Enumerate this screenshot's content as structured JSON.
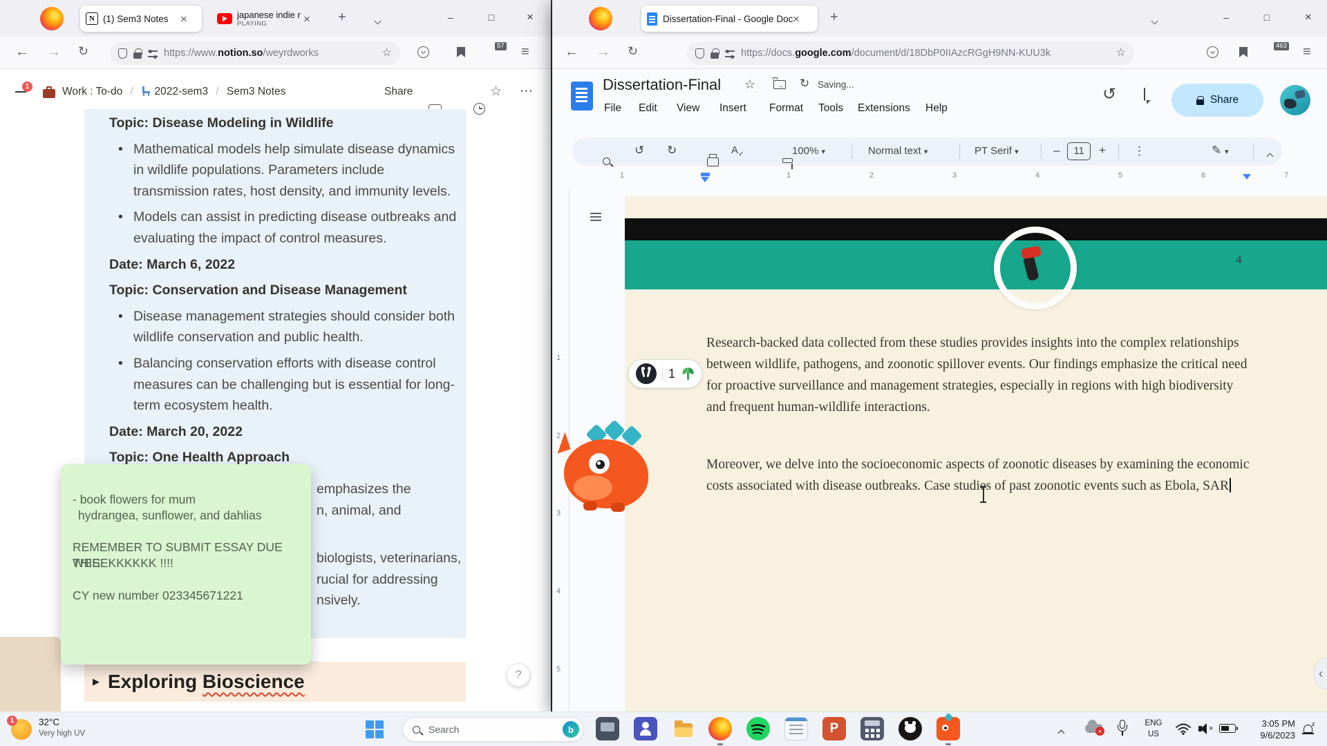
{
  "icons": {
    "back": "←",
    "forward": "→",
    "reload": "↻",
    "plus": "+",
    "close": "×",
    "menu": "≡",
    "more_h": "⋯",
    "more_v": "⋮",
    "star": "☆",
    "history": "↺",
    "chevron_left": "‹",
    "minimize": "–",
    "maximize": "□",
    "dropdown": "▾",
    "play_triangle": "▶",
    "notion_logo": "N",
    "pencil": "✎",
    "spellcheck_a": "A",
    "check": "✓",
    "letter_p": "P",
    "bing_b": "b",
    "z": "z"
  },
  "left_browser": {
    "tabs": [
      {
        "label": "(1) Sem3 Notes"
      },
      {
        "label": "japanese indie r",
        "status": "PLAYING"
      }
    ],
    "url_prefix": "https://www.",
    "url_domain": "notion.so",
    "url_path": "/weyrdworks",
    "adblock_badge": "57"
  },
  "notion": {
    "sidebar_badge": "1",
    "breadcrumb": {
      "root": "Work : To-do",
      "sep1": "/",
      "mid": "2022-sem3",
      "sep2": "/",
      "page": "Sem3 Notes"
    },
    "share_label": "Share",
    "content": {
      "topic1": "Topic: Disease Modeling in Wildlife",
      "bullet1": "Mathematical models help simulate disease dynamics in wildlife populations. Parameters include transmission rates, host density, and immunity levels.",
      "bullet2": "Models can assist in predicting disease outbreaks and evaluating the impact of control measures.",
      "date1": "Date: March 6, 2022",
      "topic2": "Topic: Conservation and Disease Management",
      "bullet3": "Disease management strategies should consider both wildlife conservation and public health.",
      "bullet4": "Balancing conservation efforts with disease control measures can be challenging but is essential for long-term ecosystem health.",
      "date2": "Date: March 20, 2022",
      "topic3": "Topic: One Health Approach",
      "fragments": [
        "emphasizes the",
        "n, animal, and",
        "biologists, veterinarians,",
        "rucial for addressing",
        "nsively."
      ]
    },
    "toggle_word1": "Exploring",
    "toggle_word2": "Bioscience",
    "help_label": "?"
  },
  "sticky_note": {
    "line1": "- book flowers for mum",
    "line2": "hydrangea, sunflower, and dahlias",
    "line3": "REMEMBER TO SUBMIT ESSAY DUE THIS",
    "line4": "WEEEKKKKKK !!!!",
    "line5": "CY new number 023345671221"
  },
  "right_browser": {
    "tab_label": "Dissertation-Final - Google Doc",
    "url_prefix": "https://docs.",
    "url_domain": "google.com",
    "url_path": "/document/d/18DbP0IIAzcRGgH9NN-KUU3k",
    "adblock_badge": "463"
  },
  "docs": {
    "title": "Dissertation-Final",
    "saving_status": "Saving...",
    "menus": [
      "File",
      "Edit",
      "View",
      "Insert",
      "Format",
      "Tools",
      "Extensions",
      "Help"
    ],
    "toolbar": {
      "zoom_level": "100%",
      "style_name": "Normal text",
      "font_name": "PT Serif",
      "font_size": "11"
    },
    "share_label": "Share",
    "ruler_top": [
      "1",
      "1",
      "2",
      "3",
      "4",
      "5",
      "6",
      "7"
    ],
    "ruler_side": [
      "1",
      "2",
      "3",
      "4",
      "5"
    ],
    "page_number": "4",
    "reaction_count": "1",
    "paragraph1": "Research-backed data collected from these studies provides insights into the complex relationships between wildlife, pathogens, and zoonotic spillover events. Our findings emphasize the critical need for proactive surveillance and management strategies, especially in regions with high biodiversity and frequent human-wildlife interactions.",
    "paragraph2": "Moreover, we delve into the socioeconomic aspects of zoonotic diseases by examining the economic costs associated with disease outbreaks. Case studies of past zoonotic events such as Ebola, SAR"
  },
  "taskbar": {
    "weather_badge": "1",
    "temperature": "32°C",
    "condition": "Very high UV",
    "search_placeholder": "Search",
    "lang_top": "ENG",
    "lang_bottom": "US",
    "time": "3:05 PM",
    "date": "9/6/2023"
  }
}
